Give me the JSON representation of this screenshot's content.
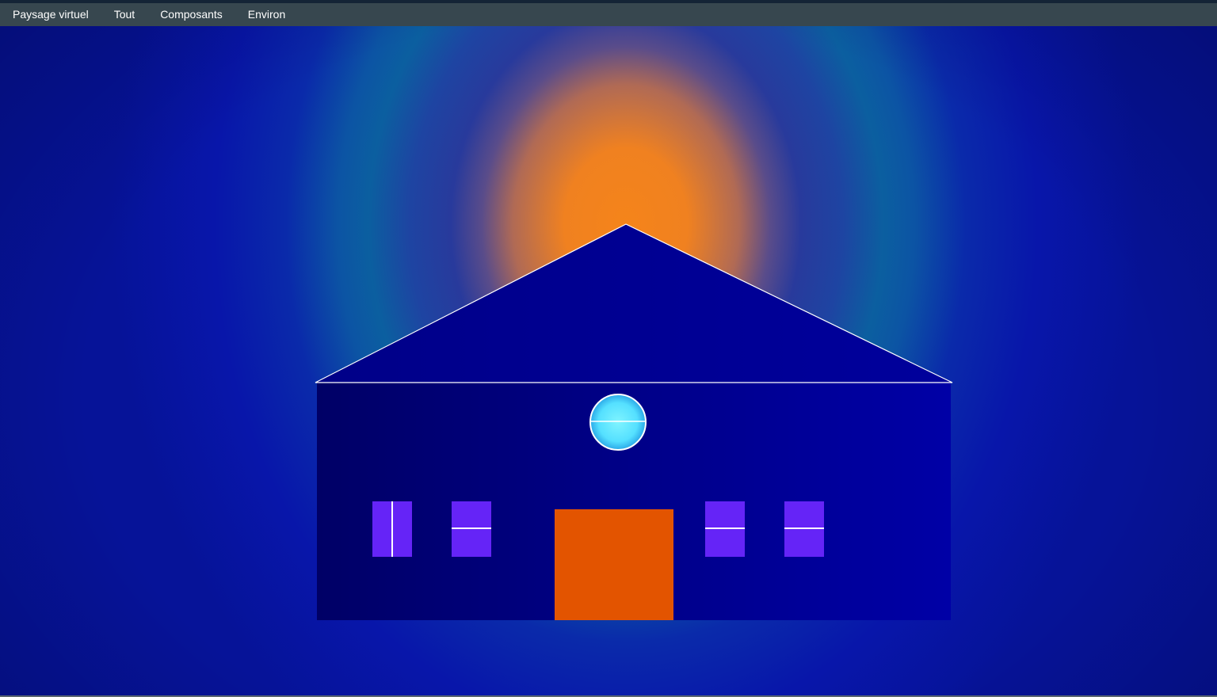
{
  "menu": {
    "items": [
      {
        "label": "Paysage virtuel"
      },
      {
        "label": "Tout"
      },
      {
        "label": "Composants"
      },
      {
        "label": "Environ"
      }
    ]
  },
  "colors": {
    "menubar": "#37474f",
    "sky_outer": "#0816aa",
    "sun": "#f5841a",
    "wall_dark": "#000066",
    "wall_light": "#0000a6",
    "roof": "#000090",
    "window": "#6524f7",
    "door": "#e35400",
    "round_window": "#64e8ff",
    "outline": "#ffffff"
  },
  "scene": {
    "windows": [
      {
        "mullion": "vertical"
      },
      {
        "mullion": "horizontal"
      },
      {
        "mullion": "horizontal"
      },
      {
        "mullion": "horizontal"
      }
    ],
    "round_window": {
      "mullion": "horizontal"
    }
  }
}
